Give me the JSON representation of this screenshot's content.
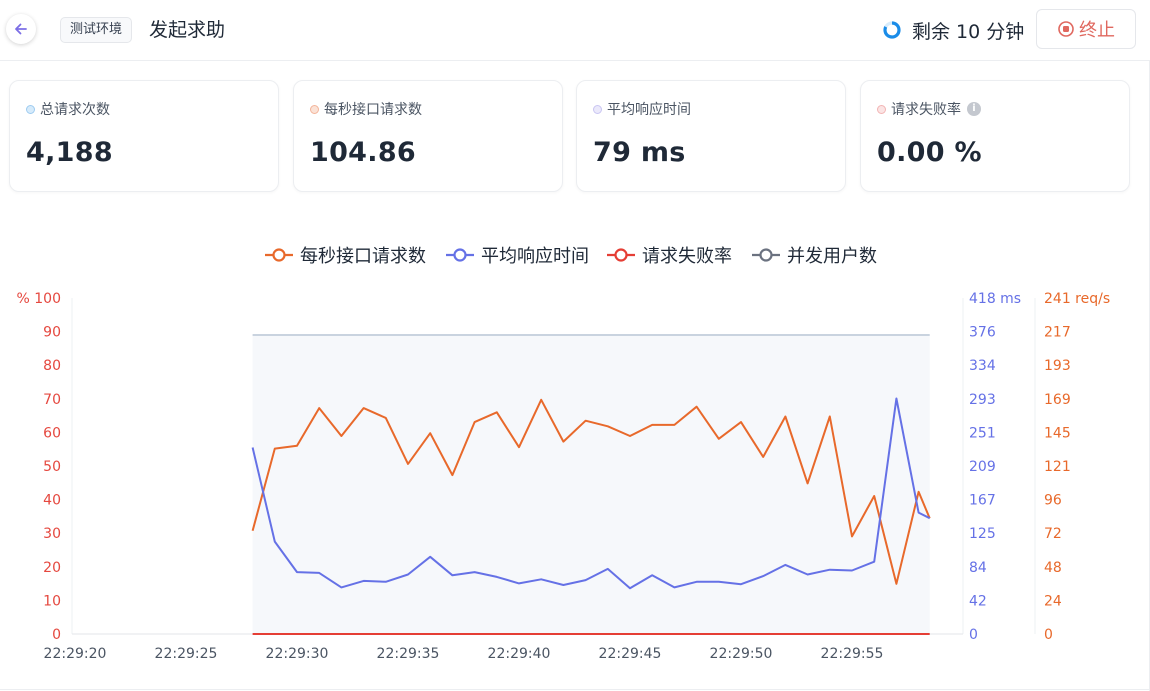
{
  "header": {
    "env_badge": "测试环境",
    "title": "发起求助",
    "remaining_label": "剩余 10 分钟",
    "stop_label": "终止"
  },
  "stats": [
    {
      "label": "总请求次数",
      "value": "4,188",
      "color": "#9ecbf0"
    },
    {
      "label": "每秒接口请求数",
      "value": "104.86",
      "color": "#f3b49a"
    },
    {
      "label": "平均响应时间",
      "value": "79 ms",
      "color": "#c9c5f2"
    },
    {
      "label": "请求失败率",
      "value": "0.00 %",
      "color": "#f2b4b4"
    }
  ],
  "colors": {
    "orange": "#e8692b",
    "blue": "#6571e6",
    "red": "#e53e35",
    "gray": "#6b7280",
    "users_line": "#c9d3df",
    "area": "#f6f8fb"
  },
  "chart_data": {
    "type": "line",
    "legend": [
      "每秒接口请求数",
      "平均响应时间",
      "请求失败率",
      "并发用户数"
    ],
    "x_ticks": [
      "22:29:20",
      "22:29:25",
      "22:29:30",
      "22:29:35",
      "22:29:40",
      "22:29:45",
      "22:29:50",
      "22:29:55"
    ],
    "x_start": "22:29:20",
    "x_end": "22:29:58.5",
    "y_left": {
      "unit": "%",
      "ticks": [
        "% 100",
        "90",
        "80",
        "70",
        "60",
        "50",
        "40",
        "30",
        "20",
        "10",
        "0"
      ],
      "ylim": [
        0,
        100
      ]
    },
    "y_ms": {
      "unit": "ms",
      "ticks": [
        "418 ms",
        "376",
        "334",
        "293",
        "251",
        "209",
        "167",
        "125",
        "84",
        "42",
        "0"
      ],
      "ylim": [
        0,
        418
      ]
    },
    "y_req": {
      "unit": "req/s",
      "ticks": [
        "241 req/s",
        "217",
        "193",
        "169",
        "145",
        "121",
        "96",
        "72",
        "48",
        "24",
        "0"
      ],
      "ylim": [
        0,
        241
      ]
    },
    "series": [
      {
        "name": "每秒接口请求数",
        "axis": "req",
        "x": [
          "22:29:28",
          "22:29:29",
          "22:29:30",
          "22:29:31",
          "22:29:32",
          "22:29:33",
          "22:29:34",
          "22:29:35",
          "22:29:36",
          "22:29:37",
          "22:29:38",
          "22:29:39",
          "22:29:40",
          "22:29:41",
          "22:29:42",
          "22:29:43",
          "22:29:44",
          "22:29:45",
          "22:29:46",
          "22:29:47",
          "22:29:48",
          "22:29:49",
          "22:29:50",
          "22:29:51",
          "22:29:52",
          "22:29:53",
          "22:29:54",
          "22:29:55",
          "22:29:56",
          "22:29:57",
          "22:29:58",
          "22:29:58.5"
        ],
        "y": [
          74,
          133,
          135,
          162,
          142,
          162,
          155,
          122,
          144,
          114,
          152,
          159,
          134,
          168,
          138,
          153,
          149,
          142,
          150,
          150,
          163,
          140,
          152,
          127,
          156,
          108,
          156,
          70,
          99,
          36,
          102,
          83
        ]
      },
      {
        "name": "平均响应时间",
        "axis": "ms",
        "x": [
          "22:29:28",
          "22:29:29",
          "22:29:30",
          "22:29:31",
          "22:29:32",
          "22:29:33",
          "22:29:34",
          "22:29:35",
          "22:29:36",
          "22:29:37",
          "22:29:38",
          "22:29:39",
          "22:29:40",
          "22:29:41",
          "22:29:42",
          "22:29:43",
          "22:29:44",
          "22:29:45",
          "22:29:46",
          "22:29:47",
          "22:29:48",
          "22:29:49",
          "22:29:50",
          "22:29:51",
          "22:29:52",
          "22:29:53",
          "22:29:54",
          "22:29:55",
          "22:29:56",
          "22:29:57",
          "22:29:58",
          "22:29:58.5"
        ],
        "y": [
          232,
          115,
          77,
          76,
          58,
          66,
          65,
          74,
          96,
          73,
          77,
          71,
          63,
          68,
          61,
          67,
          81,
          57,
          73,
          58,
          65,
          65,
          62,
          72,
          86,
          74,
          80,
          79,
          90,
          293,
          151,
          144
        ]
      },
      {
        "name": "请求失败率",
        "axis": "pct",
        "x": [
          "22:29:28",
          "22:29:58.5"
        ],
        "y": [
          0,
          0
        ]
      },
      {
        "name": "并发用户数",
        "axis": "pct",
        "x": [
          "22:29:28",
          "22:29:58.5"
        ],
        "y": [
          89,
          89
        ]
      }
    ]
  }
}
